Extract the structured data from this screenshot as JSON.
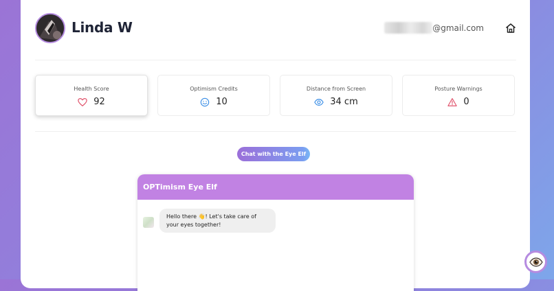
{
  "user": {
    "name": "Linda W",
    "email_suffix": "@gmail.com"
  },
  "stats": [
    {
      "label": "Health Score",
      "value": "92",
      "icon": "heart-icon",
      "color": "#e0526b"
    },
    {
      "label": "Optimism Credits",
      "value": "10",
      "icon": "smile-icon",
      "color": "#3a8ee6"
    },
    {
      "label": "Distance from Screen",
      "value": "34 cm",
      "icon": "eye-icon",
      "color": "#3a8ee6"
    },
    {
      "label": "Posture Warnings",
      "value": "0",
      "icon": "warning-icon",
      "color": "#e0526b"
    }
  ],
  "chat": {
    "open_button_label": "Chat with the Eye Elf",
    "panel_title": "OPTimism Eye Elf",
    "messages": [
      {
        "text": "Hello there 👋! Let's take care of your eyes together!"
      }
    ]
  },
  "colors": {
    "accent": "#c182e3",
    "gradient_start": "#9b74d6",
    "gradient_end": "#7ea6ea"
  }
}
